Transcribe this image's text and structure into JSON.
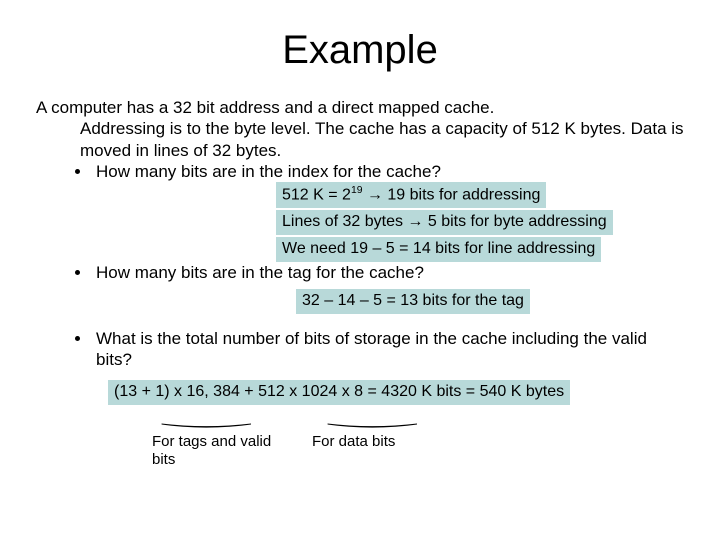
{
  "title": "Example",
  "intro_line1": "A computer has a 32 bit address and a direct mapped cache.",
  "intro_rest": "Addressing is to the byte level. The cache has a capacity of 512 K bytes. Data is moved in lines of 32 bytes.",
  "q1": "How many bits are in the index for the cache?",
  "a1a_pre": "512 K = 2",
  "a1a_exp": "19",
  "a1a_post": " →  19 bits for addressing",
  "a1b": "Lines of 32 bytes → 5 bits for byte addressing",
  "a1c": "We need 19 – 5 = 14 bits for line addressing",
  "q2": "How many bits are in the tag for the cache?",
  "a2": "32 – 14 – 5 = 13 bits for the tag",
  "q3": "What is the total number of bits of storage in the cache including the valid bits?",
  "a3": "(13 + 1) x 16, 384 + 512 x 1024 x 8 = 4320 K bits = 540 K bytes",
  "label_tags": "For tags and valid bits",
  "label_data": "For data bits"
}
